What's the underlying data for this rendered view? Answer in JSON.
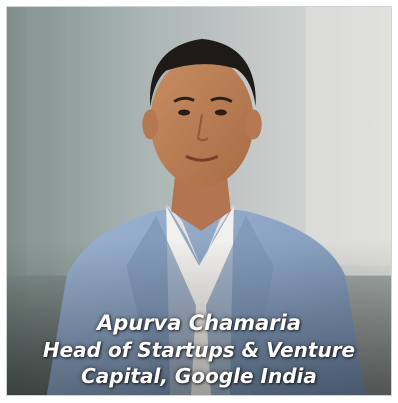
{
  "profile": {
    "name": "Apurva Chamaria",
    "title_line_1": "Head of Startups & Venture",
    "title_line_2": "Capital, Google India"
  },
  "colors": {
    "caption_text": "#ffffff",
    "jacket": "#8aa2c2",
    "shirt": "#f2f0ec",
    "background": "#9aa6a9"
  },
  "icons": {
    "photo": "portrait-photo"
  }
}
